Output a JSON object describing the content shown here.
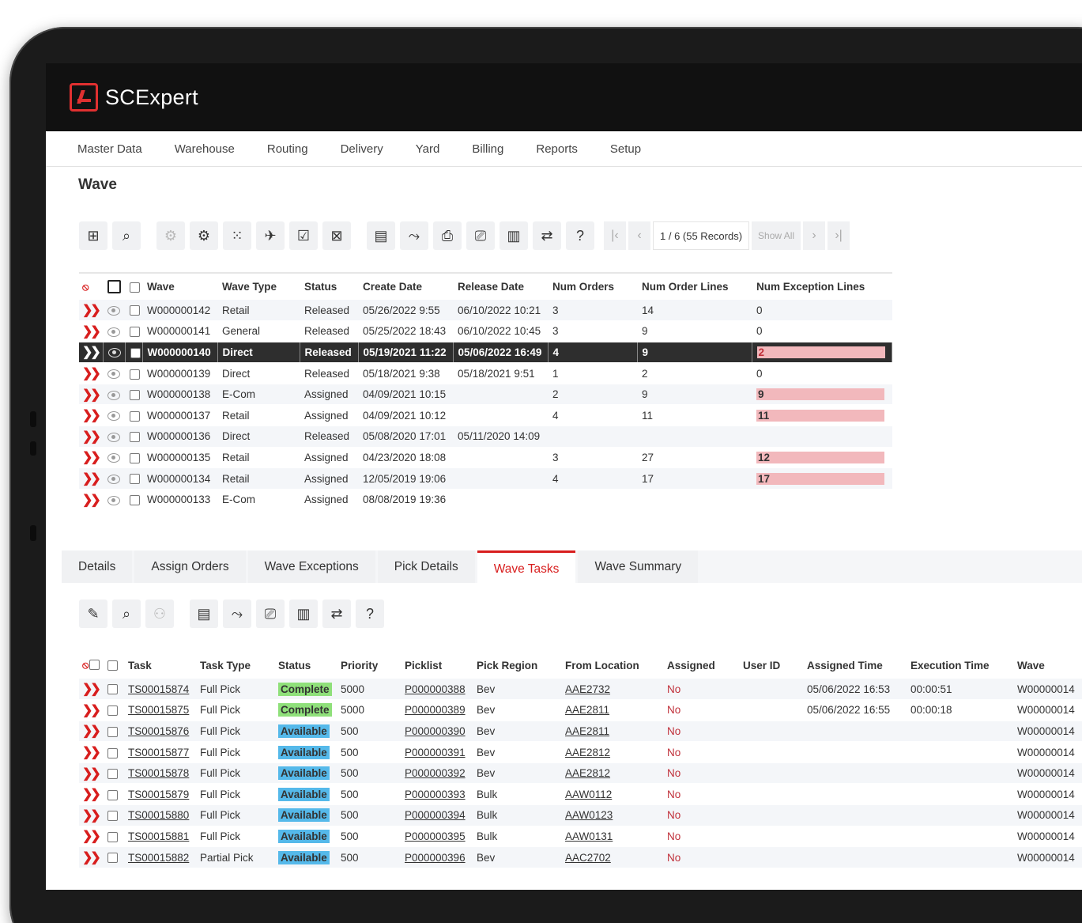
{
  "app": {
    "name": "SCExpert"
  },
  "menu": [
    "Master Data",
    "Warehouse",
    "Routing",
    "Delivery",
    "Yard",
    "Billing",
    "Reports",
    "Setup"
  ],
  "page_title": "Wave",
  "pager": {
    "info": "1 / 6 (55 Records)",
    "show_all": "Show All"
  },
  "wave_table": {
    "headers": [
      "Wave",
      "Wave Type",
      "Status",
      "Create Date",
      "Release Date",
      "Num Orders",
      "Num Order Lines",
      "Num Exception Lines"
    ],
    "rows": [
      [
        "W000000142",
        "Retail",
        "Released",
        "05/26/2022 9:55",
        "06/10/2022 10:21",
        "3",
        "14",
        "0"
      ],
      [
        "W000000141",
        "General",
        "Released",
        "05/25/2022 18:43",
        "06/10/2022 10:45",
        "3",
        "9",
        "0"
      ],
      [
        "W000000140",
        "Direct",
        "Released",
        "05/19/2021 11:22",
        "05/06/2022 16:49",
        "4",
        "9",
        "2"
      ],
      [
        "W000000139",
        "Direct",
        "Released",
        "05/18/2021 9:38",
        "05/18/2021 9:51",
        "1",
        "2",
        "0"
      ],
      [
        "W000000138",
        "E-Com",
        "Assigned",
        "04/09/2021 10:15",
        "",
        "2",
        "9",
        "9"
      ],
      [
        "W000000137",
        "Retail",
        "Assigned",
        "04/09/2021 10:12",
        "",
        "4",
        "11",
        "11"
      ],
      [
        "W000000136",
        "Direct",
        "Released",
        "05/08/2020 17:01",
        "05/11/2020 14:09",
        "",
        "",
        ""
      ],
      [
        "W000000135",
        "Retail",
        "Assigned",
        "04/23/2020 18:08",
        "",
        "3",
        "27",
        "12"
      ],
      [
        "W000000134",
        "Retail",
        "Assigned",
        "12/05/2019 19:06",
        "",
        "4",
        "17",
        "17"
      ],
      [
        "W000000133",
        "E-Com",
        "Assigned",
        "08/08/2019 19:36",
        "",
        "",
        "",
        ""
      ]
    ]
  },
  "tabs": [
    "Details",
    "Assign Orders",
    "Wave Exceptions",
    "Pick Details",
    "Wave Tasks",
    "Wave Summary"
  ],
  "task_table": {
    "headers": [
      "Task",
      "Task Type",
      "Status",
      "Priority",
      "Picklist",
      "Pick Region",
      "From Location",
      "Assigned",
      "User ID",
      "Assigned Time",
      "Execution Time",
      "Wave"
    ],
    "rows": [
      [
        "TS00015874",
        "Full Pick",
        "Complete",
        "5000",
        "P000000388",
        "Bev",
        "AAE2732",
        "No",
        "",
        "05/06/2022 16:53",
        "00:00:51",
        "W00000014"
      ],
      [
        "TS00015875",
        "Full Pick",
        "Complete",
        "5000",
        "P000000389",
        "Bev",
        "AAE2811",
        "No",
        "",
        "05/06/2022 16:55",
        "00:00:18",
        "W00000014"
      ],
      [
        "TS00015876",
        "Full Pick",
        "Available",
        "500",
        "P000000390",
        "Bev",
        "AAE2811",
        "No",
        "",
        "",
        "",
        "W00000014"
      ],
      [
        "TS00015877",
        "Full Pick",
        "Available",
        "500",
        "P000000391",
        "Bev",
        "AAE2812",
        "No",
        "",
        "",
        "",
        "W00000014"
      ],
      [
        "TS00015878",
        "Full Pick",
        "Available",
        "500",
        "P000000392",
        "Bev",
        "AAE2812",
        "No",
        "",
        "",
        "",
        "W00000014"
      ],
      [
        "TS00015879",
        "Full Pick",
        "Available",
        "500",
        "P000000393",
        "Bulk",
        "AAW0112",
        "No",
        "",
        "",
        "",
        "W00000014"
      ],
      [
        "TS00015880",
        "Full Pick",
        "Available",
        "500",
        "P000000394",
        "Bulk",
        "AAW0123",
        "No",
        "",
        "",
        "",
        "W00000014"
      ],
      [
        "TS00015881",
        "Full Pick",
        "Available",
        "500",
        "P000000395",
        "Bulk",
        "AAW0131",
        "No",
        "",
        "",
        "",
        "W00000014"
      ],
      [
        "TS00015882",
        "Partial Pick",
        "Available",
        "500",
        "P000000396",
        "Bev",
        "AAC2702",
        "No",
        "",
        "",
        "",
        "W00000014"
      ]
    ]
  },
  "colors": {
    "brand_red": "#d81e1e",
    "header_bg": "#111111",
    "complete": "#8fe07a",
    "available": "#55b9ea",
    "exception": "#f2b8bc"
  }
}
